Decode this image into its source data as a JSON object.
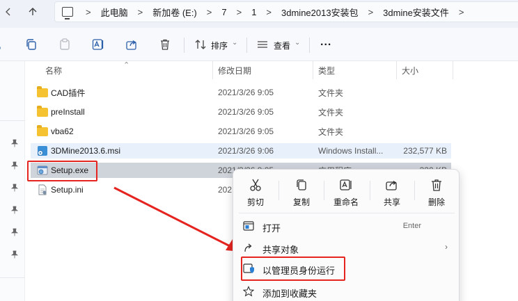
{
  "address": {
    "crumbs": [
      "此电脑",
      "新加卷 (E:)",
      "7",
      "1",
      "3dmine2013安装包",
      "3dmine安装文件"
    ]
  },
  "toolbar": {
    "sort_label": "排序",
    "view_label": "查看",
    "more_label": "..."
  },
  "columns": {
    "name": "名称",
    "date": "修改日期",
    "type": "类型",
    "size": "大小"
  },
  "files": [
    {
      "name": "CAD插件",
      "date": "2021/3/26 9:05",
      "type": "文件夹",
      "size": "",
      "icon": "folder-icon"
    },
    {
      "name": "preInstall",
      "date": "2021/3/26 9:05",
      "type": "文件夹",
      "size": "",
      "icon": "folder-icon"
    },
    {
      "name": "vba62",
      "date": "2021/3/26 9:05",
      "type": "文件夹",
      "size": "",
      "icon": "folder-icon"
    },
    {
      "name": "3DMine2013.6.msi",
      "date": "2021/3/26 9:06",
      "type": "Windows Install...",
      "size": "232,577 KB",
      "icon": "msi-icon"
    },
    {
      "name": "Setup.exe",
      "date": "2021/3/26 9:05",
      "type": "应用程序",
      "size": "320 KB",
      "icon": "exe-icon"
    },
    {
      "name": "Setup.ini",
      "date": "202",
      "type": "",
      "size": "",
      "icon": "ini-icon"
    }
  ],
  "context_menu": {
    "quick": [
      {
        "label": "剪切",
        "icon": "scissors-icon"
      },
      {
        "label": "复制",
        "icon": "copy-icon"
      },
      {
        "label": "重命名",
        "icon": "rename-icon"
      },
      {
        "label": "共享",
        "icon": "share-icon"
      },
      {
        "label": "删除",
        "icon": "trash-icon"
      }
    ],
    "items": [
      {
        "label": "打开",
        "shortcut": "Enter",
        "icon": "open-icon"
      },
      {
        "label": "共享对象",
        "shortcut": "",
        "icon": "share-with-icon",
        "submenu": true
      },
      {
        "label": "以管理员身份运行",
        "shortcut": "",
        "icon": "shield-icon"
      },
      {
        "label": "添加到收藏夹",
        "shortcut": "",
        "icon": "star-icon"
      }
    ]
  },
  "colors": {
    "highlight": "#e52420",
    "folder": "#f5c232",
    "accent": "#0067c0"
  }
}
